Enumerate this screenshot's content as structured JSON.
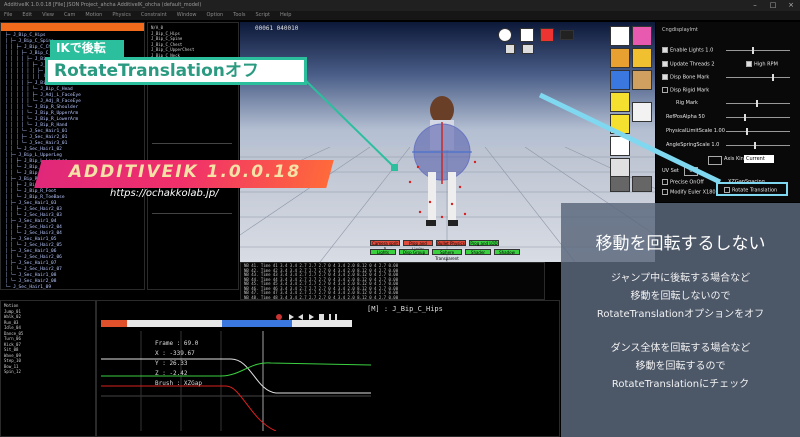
{
  "titlebar": {
    "text": "AdditiveIK 1.0.0.18 [File] JSON  Project_ahcha  AdditiveIK_ohcha  (default_model)",
    "controls": [
      "–",
      "□",
      "×"
    ]
  },
  "menubar": {
    "items": [
      "File",
      "Edit",
      "View",
      "Cam",
      "Motion",
      "Physics",
      "Constraint",
      "Window",
      "Option",
      "Tools",
      "Script",
      "Help"
    ]
  },
  "tree": {
    "lines": [
      "├─ J_Bip_C_Hips",
      "│  ├─ J_Bip_C_Spine",
      "│  │  ├─ J_Bip_C_Chest",
      "│  │  │  ├─ J_Bip_C_UpperChest",
      "│  │  │  │  ├─ J_Bip_L_Shoulder",
      "│  │  │  │  │  ├─ J_Bip_L_UpperArm",
      "│  │  │  │  │  │  ├─ J_Bip_L_LowerArm",
      "│  │  │  │  │  │  │  └─ J_Bip_L_Hand",
      "│  │  │  │  ├─ J_Bip_C_Neck",
      "│  │  │  │  │  └─ J_Bip_C_Head",
      "│  │  │  │  │     ├─ J_Adj_L_FaceEye",
      "│  │  │  │  │     └─ J_Adj_R_FaceEye",
      "│  │  │  │  └─ J_Bip_R_Shoulder",
      "│  │  │  │     └─ J_Bip_R_UpperArm",
      "│  │  │  │        └─ J_Bip_R_LowerArm",
      "│  │  │  │           └─ J_Bip_R_Hand",
      "│  │  │  └─ J_Sec_Hair1_01",
      "│  │  │     ├─ J_Sec_Hair2_01",
      "│  │  │     └─ J_Sec_Hair3_01",
      "│  │  └─ J_Sec_Hair1_02",
      "│  ├─ J_Bip_L_UpperLeg",
      "│  │  ├─ J_Bip_L_LowerLeg",
      "│  │  └─ J_Bip_L_Foot",
      "│  │     └─ J_Bip_L_ToeBase",
      "│  ├─ J_Bip_R_UpperLeg",
      "│  │  ├─ J_Bip_R_LowerLeg",
      "│  │  └─ J_Bip_R_Foot",
      "│  │     └─ J_Bip_R_ToeBase",
      "│  ├─ J_Sec_Hair1_03",
      "│  │  ├─ J_Sec_Hair2_03",
      "│  │  └─ J_Sec_Hair3_03",
      "│  ├─ J_Sec_Hair1_04",
      "│  │  ├─ J_Sec_Hair2_04",
      "│  │  └─ J_Sec_Hair3_04",
      "│  ├─ J_Sec_Hair1_05",
      "│  │  └─ J_Sec_Hair2_05",
      "│  ├─ J_Sec_Hair1_06",
      "│  │  └─ J_Sec_Hair2_06",
      "│  ├─ J_Sec_Hair1_07",
      "│  │  └─ J_Sec_Hair2_07",
      "│  └─ J_Sec_Hair1_08",
      "│     └─ J_Sec_Hair2_08",
      "└─ J_Sec_Hair1_09"
    ]
  },
  "sidepane": {
    "lines": [
      "N/A_0",
      "J_Bip_C_Hips",
      "J_Bip_C_Spine",
      "J_Bip_C_Chest",
      "J_Bip_C_UpperChest",
      "J_Bip_C_Neck",
      "J_Bip_C_Head",
      "J_Adj_L_FaceEye",
      "J_Adj_R_FaceEye",
      "J_Bip_L_Shoulder",
      "J_Bip_L_UpperArm"
    ]
  },
  "viewport": {
    "fps_text": "00061  040010",
    "buttons_row1": [
      "Camera sprit B",
      "Prop and Limits",
      "Bullet Physics",
      "Prog and LOD"
    ],
    "buttons_row2": [
      "Lights",
      "Disp Group",
      "Sphere Transparent",
      "Shader",
      "Shadow"
    ]
  },
  "log": {
    "lines": [
      "NB 41. Time 41 3.4 3.4 2.7 2.7 2.7 0 4 3.4 2.0 8.12 0 4 2.7 0.00",
      "NB 42. Time 42 3.4 3.4 2.7 2.7 2.7 0 4 3.4 2.0 8.12 0 4 2.7 0.00",
      "NB 43. Time 43 3.4 3.4 2.7 2.7 2.7 0 4 3.4 2.0 8.12 0 4 2.7 0.00",
      "NB 44. Time 44 3.4 3.4 2.7 2.7 2.7 0 4 3.4 2.0 8.12 0 4 2.7 0.00",
      "NB 45. Time 45 3.4 3.4 2.7 2.7 2.7 0 4 3.4 2.0 8.12 0 4 2.7 0.00",
      "NB 46. Time 46 3.4 3.4 2.7 2.7 2.7 0 4 3.4 2.0 8.12 0 4 2.7 0.00",
      "NB 47. Time 47 3.4 3.4 2.7 2.7 2.7 0 4 3.4 2.0 8.12 0 4 2.7 0.00",
      "NB 48. Time 48 3.4 3.4 2.7 2.7 2.7 0 4 3.4 2.0 8.12 0 4 2.7 0.00"
    ]
  },
  "bottomleft": {
    "lines": [
      "Motion",
      "Jump_01",
      "Walk_02",
      "Run_03",
      "Idle_04",
      "Dance_05",
      "Turn_06",
      "Kick_07",
      "Sit_08",
      "Wave_09",
      "Step_10",
      "Bow_11",
      "Spin_12"
    ]
  },
  "timeline": {
    "bone_name": "[M] : J_Bip_C_Hips",
    "frame_label": "Frame : 69.0",
    "x_label": "X : -339.67",
    "y_label": "Y : 26.33",
    "z_label": "Z : -2.42",
    "brush_label": "Brush : XZGap"
  },
  "params": {
    "title": "Cngdisplaylmt",
    "enable_lights": "Enable Lights 1.0",
    "update_threads": "Update Threads 2",
    "high_rpm": "High RPM",
    "disp_bone_mark": "Disp Bone Mark",
    "disp_rigid_mark": "Disp Rigid Mark",
    "rig_mark": "Rig Mark",
    "refpos_alpha": "RefPosAlpha 50",
    "physical_limit": "PhysicalLimitScale 1.00",
    "angle_spring": "AngleSpringScale 1.0",
    "axis_kind_label": "Axis Kind",
    "axis_kind_value": "Current",
    "uv_set": "UV Set",
    "uv_set_value": "0",
    "precise_onoff": "Precise OnOff",
    "xz_gap_cc": "XZGapSpacing",
    "modify_euler": "Modify Euler X180",
    "rotate_translation": "Rotate Translation"
  },
  "callouts": {
    "ik_backflip": "IKで後転",
    "rotate_off": "RotateTranslationオフ"
  },
  "brand": {
    "title": "ADDITIVEIK 1.0.0.18",
    "url": "https://ochakkolab.jp/"
  },
  "overlay": {
    "heading": "移動を回転するしない",
    "para1_line1": "ジャンプ中に後転する場合など",
    "para1_line2": "移動を回転しないので",
    "para1_line3": "RotateTranslationオプションをオフ",
    "para2_line1": "ダンス全体を回転する場合など",
    "para2_line2": "移動を回転するので",
    "para2_line3": "RotateTranslationにチェック"
  },
  "colors": {
    "accent_teal": "#2cbf9d",
    "tree_header_orange": "#f26a1b",
    "highlight_cyan": "#7fd8f0",
    "brand_pink": "#e0287a",
    "brand_text": "#f6e2a6"
  }
}
